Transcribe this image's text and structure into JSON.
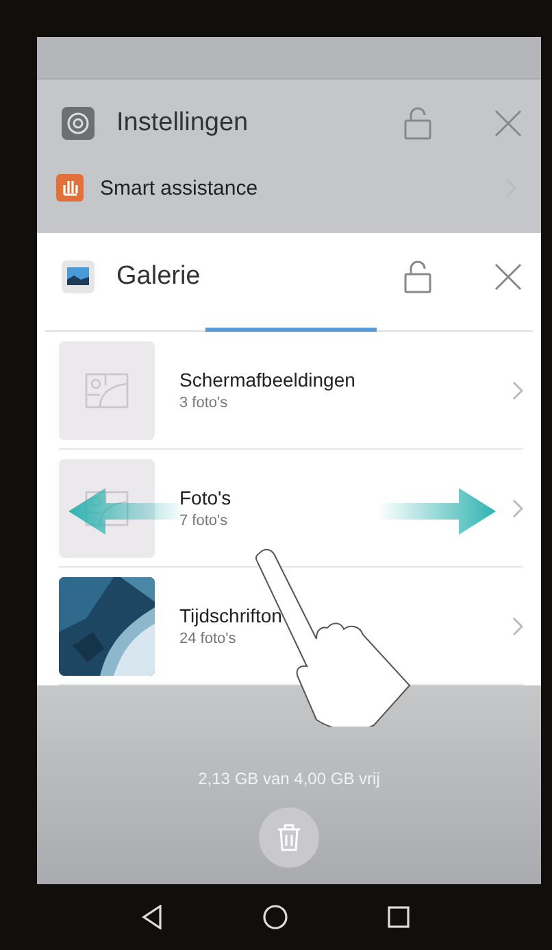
{
  "back_card": {
    "title": "Instellingen",
    "item": {
      "label": "Smart assistance"
    }
  },
  "front_card": {
    "title": "Galerie",
    "albums": [
      {
        "kind": "placeholder",
        "name": "Schermafbeeldingen",
        "count": "3 foto's"
      },
      {
        "kind": "placeholder",
        "name": "Foto's",
        "count": "7 foto's"
      },
      {
        "kind": "picture",
        "name": "Tijdschrifton",
        "count": "24 foto's"
      }
    ]
  },
  "storage": "2,13 GB van 4,00 GB vrij"
}
